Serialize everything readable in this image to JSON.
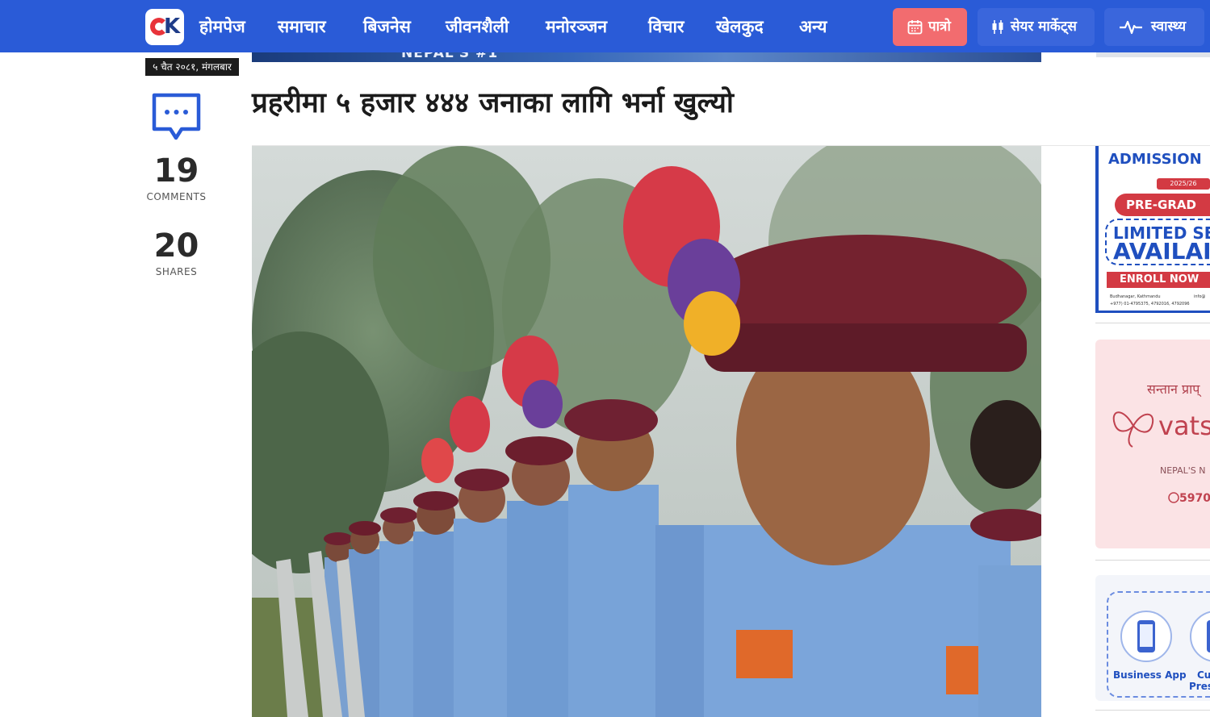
{
  "nav": {
    "logo_alt": "OK",
    "links": [
      "होमपेज",
      "समाचार",
      "बिजनेस",
      "जीवनशैली",
      "मनोरञ्जन",
      "विचार",
      "खेलकुद",
      "अन्य"
    ],
    "patro_label": "पात्रो",
    "share_market_label": "सेयर मार्केट्स",
    "health_label": "स्वास्थ्य"
  },
  "top_banner_text": "NEPAL'S #1",
  "date_badge": "५ चैत २०८१, मंगलबार",
  "stats": {
    "comments_count": "19",
    "comments_label": "COMMENTS",
    "shares_count": "20",
    "shares_label": "SHARES"
  },
  "article": {
    "headline": "प्रहरीमा ५ हजार ४४४ जनाका लागि भर्ना खुल्यो"
  },
  "ads": {
    "admission": {
      "title": "ADMISSION",
      "year": "2025/26",
      "pre_grad": "PRE-GRAD",
      "limited": "LIMITED SE",
      "available": "AVAILAI",
      "enroll": "ENROLL NOW",
      "address": "Budhanagar, Kathmandu",
      "phone": "+977) 01-4795375, 4792016, 4792096",
      "email": "info@"
    },
    "vats": {
      "tagline": "सन्तान प्राप्",
      "brand": "vats",
      "sub": "NEPAL'S N",
      "phone": "5970"
    },
    "app": {
      "label1": "Business App",
      "label2a": "Cu",
      "label2b": "Pres"
    }
  },
  "colors": {
    "nav_bg": "#2a5bd7",
    "patro_bg": "#f26c6f",
    "pill_bg": "#3a66dc",
    "date_bg": "#1c1c1c",
    "accent_blue": "#1f4fbf",
    "admission_red": "#d33a43"
  }
}
